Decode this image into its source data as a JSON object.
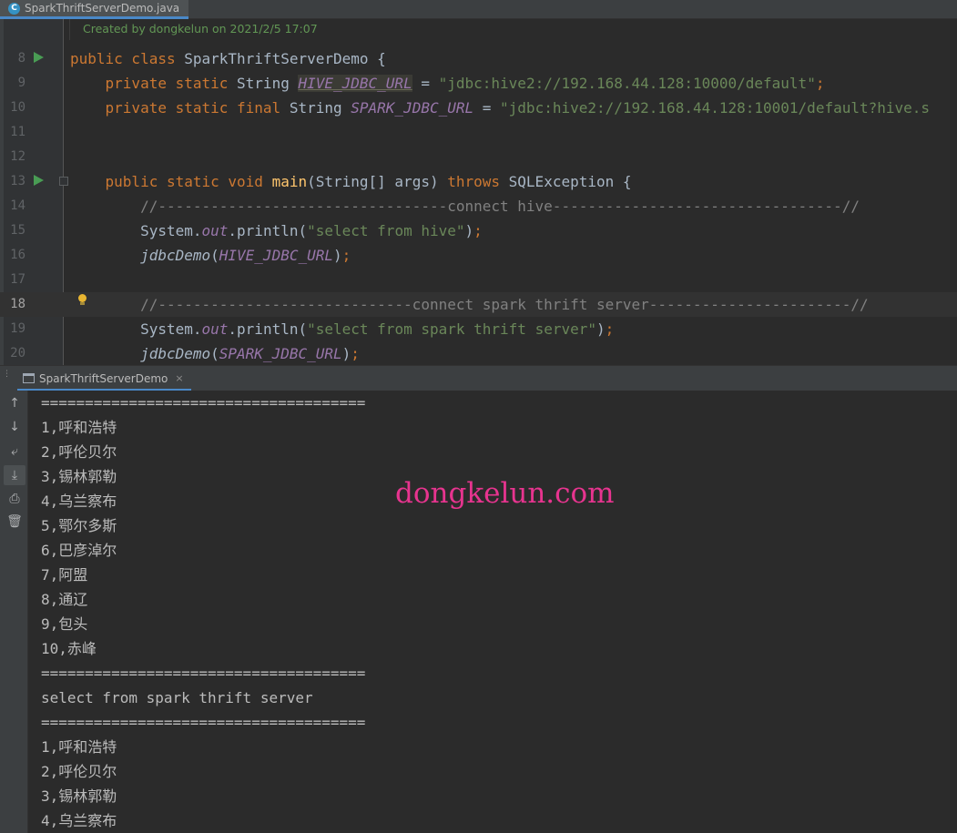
{
  "editor_tab": {
    "icon_letter": "C",
    "label": "SparkThriftServerDemo.java",
    "close": "×"
  },
  "annotation": "Created by dongkelun on 2021/2/5 17:07",
  "editor": {
    "lines": [
      {
        "num": "8",
        "tokens": [
          [
            "kw",
            "public class "
          ],
          [
            "",
            "SparkThriftServerDemo {"
          ]
        ]
      },
      {
        "num": "9",
        "tokens": [
          [
            "",
            "    "
          ],
          [
            "kw",
            "private static "
          ],
          [
            "",
            "String "
          ],
          [
            "fld-hl",
            "HIVE_JDBC_URL"
          ],
          [
            "",
            " = "
          ],
          [
            "str",
            "\"jdbc:hive2://192.168.44.128:10000/default\""
          ],
          [
            "kw",
            ";"
          ]
        ]
      },
      {
        "num": "10",
        "tokens": [
          [
            "",
            "    "
          ],
          [
            "kw",
            "private static final "
          ],
          [
            "",
            "String "
          ],
          [
            "fld",
            "SPARK_JDBC_URL"
          ],
          [
            "",
            " = "
          ],
          [
            "str",
            "\"jdbc:hive2://192.168.44.128:10001/default?hive.s"
          ]
        ]
      },
      {
        "num": "11",
        "tokens": []
      },
      {
        "num": "12",
        "tokens": []
      },
      {
        "num": "13",
        "tokens": [
          [
            "",
            "    "
          ],
          [
            "kw",
            "public static void "
          ],
          [
            "mth",
            "main"
          ],
          [
            "",
            "(String[] args) "
          ],
          [
            "kw",
            "throws "
          ],
          [
            "",
            "SQLException {"
          ]
        ]
      },
      {
        "num": "14",
        "tokens": [
          [
            "",
            "        "
          ],
          [
            "cmt",
            "//---------------------------------connect hive---------------------------------//"
          ]
        ]
      },
      {
        "num": "15",
        "tokens": [
          [
            "",
            "        System."
          ],
          [
            "fld",
            "out"
          ],
          [
            "",
            ".println("
          ],
          [
            "str",
            "\"select from hive\""
          ],
          [
            "",
            ")"
          ],
          [
            "kw",
            ";"
          ]
        ]
      },
      {
        "num": "16",
        "tokens": [
          [
            "",
            "        "
          ],
          [
            "ital",
            "jdbcDemo"
          ],
          [
            "",
            "("
          ],
          [
            "fld",
            "HIVE_JDBC_URL"
          ],
          [
            "",
            ")"
          ],
          [
            "kw",
            ";"
          ]
        ]
      },
      {
        "num": "17",
        "tokens": []
      },
      {
        "num": "18",
        "tokens": [
          [
            "",
            "        "
          ],
          [
            "cmt",
            "//-----------------------------connect spark thrift server-----------------------//"
          ]
        ]
      },
      {
        "num": "19",
        "tokens": [
          [
            "",
            "        System."
          ],
          [
            "fld",
            "out"
          ],
          [
            "",
            ".println("
          ],
          [
            "str",
            "\"select from spark thrift server\""
          ],
          [
            "",
            ")"
          ],
          [
            "kw",
            ";"
          ]
        ]
      },
      {
        "num": "20",
        "tokens": [
          [
            "",
            "        "
          ],
          [
            "ital",
            "jdbcDemo"
          ],
          [
            "",
            "("
          ],
          [
            "fld",
            "SPARK_JDBC_URL"
          ],
          [
            "",
            ")"
          ],
          [
            "kw",
            ";"
          ]
        ]
      }
    ]
  },
  "run_tab": {
    "label": "SparkThriftServerDemo",
    "close": "×"
  },
  "run_toolbar": {
    "icons": [
      "arrow-up-icon",
      "arrow-down-icon",
      "soft-wrap-icon",
      "scroll-to-end-icon",
      "print-icon",
      "trash-icon"
    ],
    "glyphs": [
      "↑",
      "↓",
      "⤶",
      "⤓",
      "⎙",
      "🗑"
    ]
  },
  "console": {
    "lines": [
      "=====================================",
      "1,呼和浩特",
      "2,呼伦贝尔",
      "3,锡林郭勒",
      "4,乌兰察布",
      "5,鄂尔多斯",
      "6,巴彦淖尔",
      "7,阿盟",
      "8,通辽",
      "9,包头",
      "10,赤峰",
      "=====================================",
      "select from spark thrift server",
      "=====================================",
      "1,呼和浩特",
      "2,呼伦贝尔",
      "3,锡林郭勒",
      "4,乌兰察布"
    ]
  },
  "watermark": "dongkelun.com",
  "colors": {
    "keyword": "#cc7832",
    "string": "#6a8759",
    "field": "#9876aa",
    "method": "#ffc66d",
    "comment": "#808080",
    "run_arrow": "#499c54",
    "watermark": "#e7348f"
  }
}
